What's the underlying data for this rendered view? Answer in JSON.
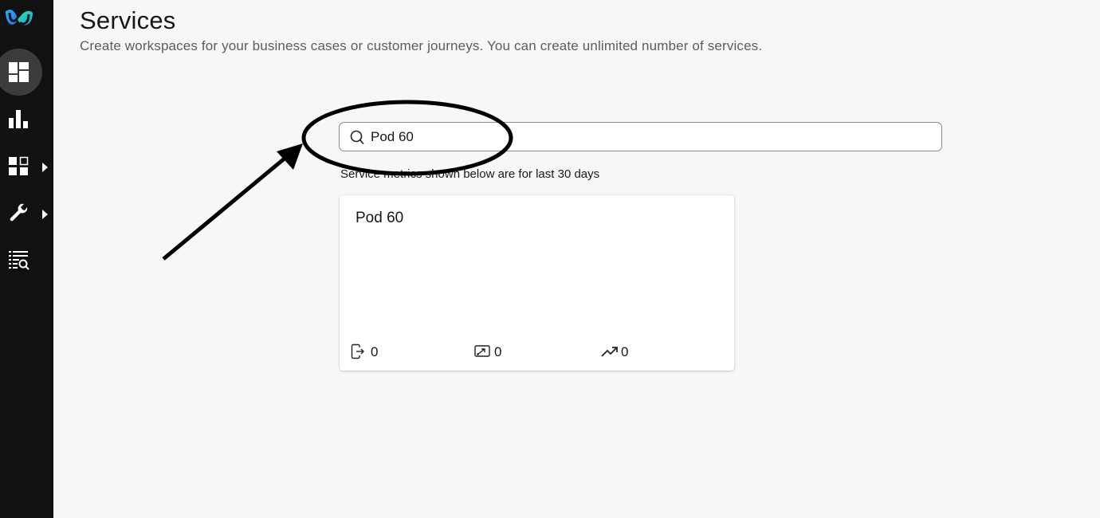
{
  "sidebar": {
    "logo": "webex-logo",
    "items": [
      {
        "icon": "dashboard-icon",
        "active": true,
        "has_submenu": false
      },
      {
        "icon": "bar-chart-icon",
        "active": false,
        "has_submenu": false
      },
      {
        "icon": "apps-grid-icon",
        "active": false,
        "has_submenu": true
      },
      {
        "icon": "wrench-icon",
        "active": false,
        "has_submenu": true
      },
      {
        "icon": "list-search-icon",
        "active": false,
        "has_submenu": false
      }
    ]
  },
  "header": {
    "title": "Services",
    "subtitle": "Create workspaces for your business cases or customer journeys. You can create unlimited number of services."
  },
  "search": {
    "value": "Pod 60",
    "icon": "search-icon"
  },
  "metrics_note": "Service metrics shown below are for last 30 days",
  "cards": [
    {
      "title": "Pod 60",
      "metrics": [
        {
          "icon": "exit-icon",
          "value": "0"
        },
        {
          "icon": "screen-share-icon",
          "value": "0"
        },
        {
          "icon": "trending-up-icon",
          "value": "0"
        }
      ]
    }
  ],
  "colors": {
    "sidebar_bg": "#111111",
    "active_item_bg": "#3c3c3c",
    "page_bg": "#f7f7f7",
    "annotation": "#000000"
  }
}
